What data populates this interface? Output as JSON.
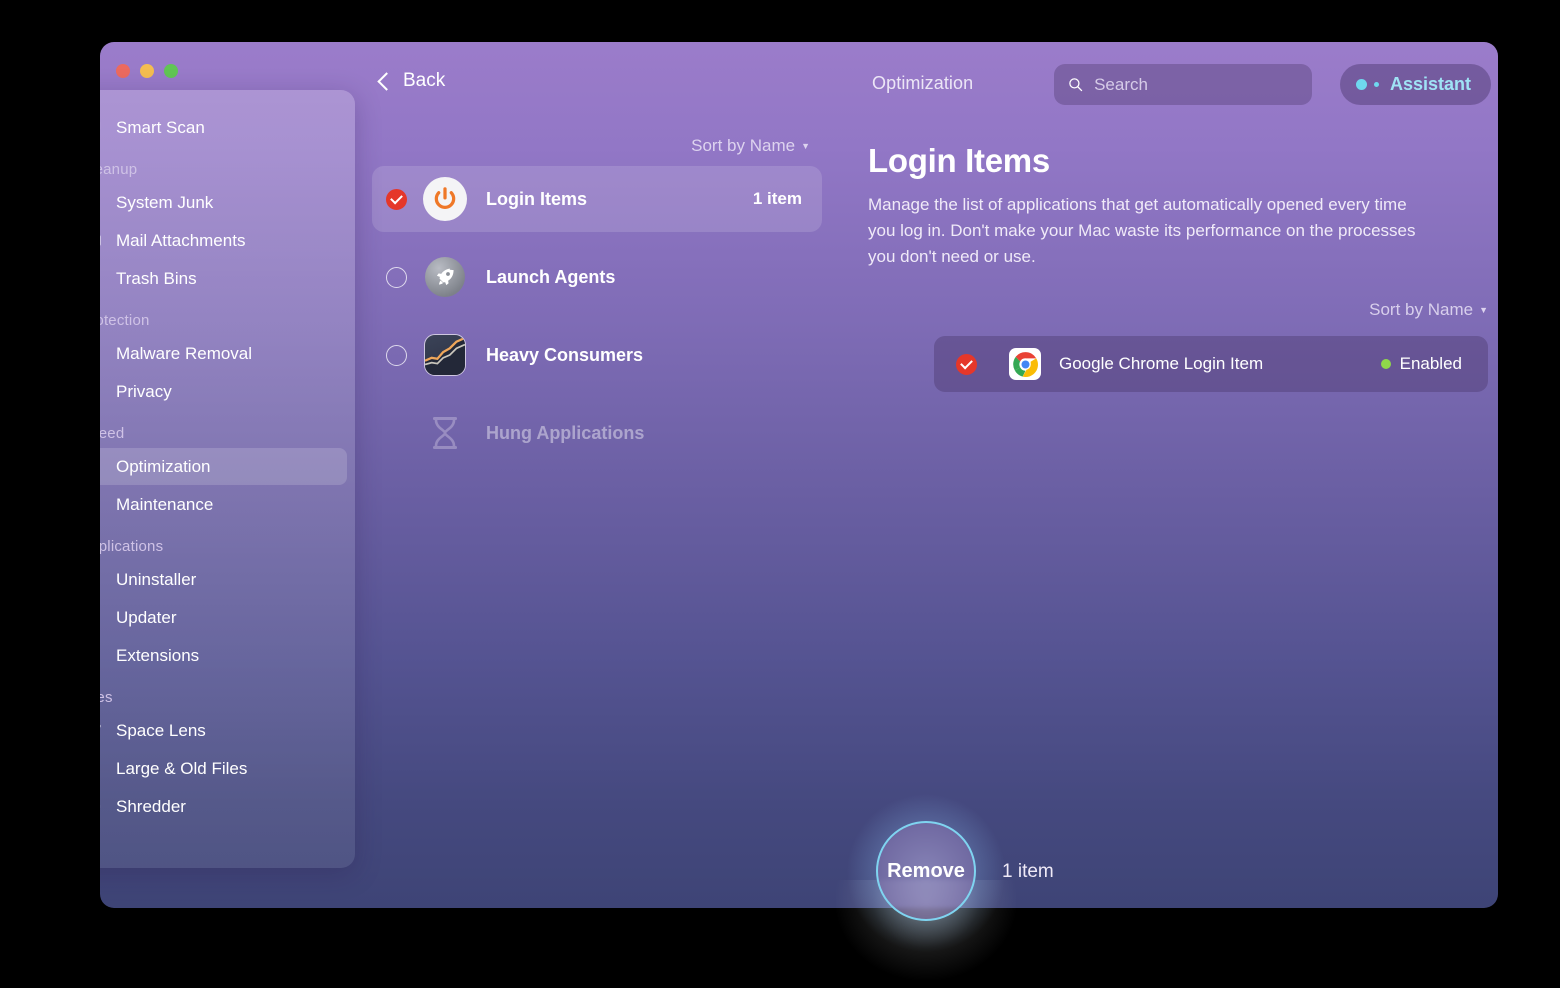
{
  "window": {
    "traffic_lights": [
      "close",
      "minimize",
      "zoom"
    ],
    "back_label": "Back",
    "breadcrumb": "Optimization",
    "search_placeholder": "Search",
    "search_value": "",
    "assistant_label": "Assistant"
  },
  "sidebar": {
    "groups": [
      {
        "label": "",
        "items": [
          {
            "label": "Smart Scan",
            "icon": "monitor-icon",
            "active": false
          }
        ]
      },
      {
        "label": "Cleanup",
        "items": [
          {
            "label": "System Junk",
            "icon": "broom-icon",
            "active": false
          },
          {
            "label": "Mail Attachments",
            "icon": "mail-icon",
            "active": false
          },
          {
            "label": "Trash Bins",
            "icon": "trash-icon",
            "active": false
          }
        ]
      },
      {
        "label": "Protection",
        "items": [
          {
            "label": "Malware Removal",
            "icon": "biohazard-icon",
            "active": false
          },
          {
            "label": "Privacy",
            "icon": "hand-icon",
            "active": false
          }
        ]
      },
      {
        "label": "Speed",
        "items": [
          {
            "label": "Optimization",
            "icon": "sliders-icon",
            "active": true
          },
          {
            "label": "Maintenance",
            "icon": "wrench-icon",
            "active": false
          }
        ]
      },
      {
        "label": "Applications",
        "items": [
          {
            "label": "Uninstaller",
            "icon": "molecule-icon",
            "active": false
          },
          {
            "label": "Updater",
            "icon": "refresh-arrow-icon",
            "active": false
          },
          {
            "label": "Extensions",
            "icon": "puzzle-icon",
            "active": false
          }
        ]
      },
      {
        "label": "Files",
        "items": [
          {
            "label": "Space Lens",
            "icon": "planet-icon",
            "active": false
          },
          {
            "label": "Large & Old Files",
            "icon": "folder-icon",
            "active": false
          },
          {
            "label": "Shredder",
            "icon": "shredder-icon",
            "active": false
          }
        ]
      }
    ]
  },
  "middle": {
    "sort_label": "Sort by Name",
    "categories": [
      {
        "name": "Login Items",
        "count": "1 item",
        "icon": "power-icon",
        "checked": true,
        "selected": true,
        "disabled": false
      },
      {
        "name": "Launch Agents",
        "count": "",
        "icon": "rocket-icon",
        "checked": false,
        "selected": false,
        "disabled": false
      },
      {
        "name": "Heavy Consumers",
        "count": "",
        "icon": "activity-graph-icon",
        "checked": false,
        "selected": false,
        "disabled": false
      },
      {
        "name": "Hung Applications",
        "count": "",
        "icon": "hourglass-icon",
        "checked": false,
        "selected": false,
        "disabled": true
      }
    ]
  },
  "detail": {
    "title": "Login Items",
    "description": "Manage the list of applications that get automatically opened every time you log in. Don't make your Mac waste its performance on the processes you don't need or use.",
    "sort_label": "Sort by Name",
    "items": [
      {
        "name": "Google Chrome Login Item",
        "status": "Enabled",
        "icon": "chrome-icon",
        "checked": true
      }
    ]
  },
  "footer": {
    "action_label": "Remove",
    "count_label": "1 item"
  },
  "colors": {
    "accent_red": "#e5372a",
    "accent_cyan": "#7fd4f0",
    "status_green": "#8fd94a",
    "bg_top": "#9b7cca",
    "bg_bottom": "#3e4476"
  }
}
